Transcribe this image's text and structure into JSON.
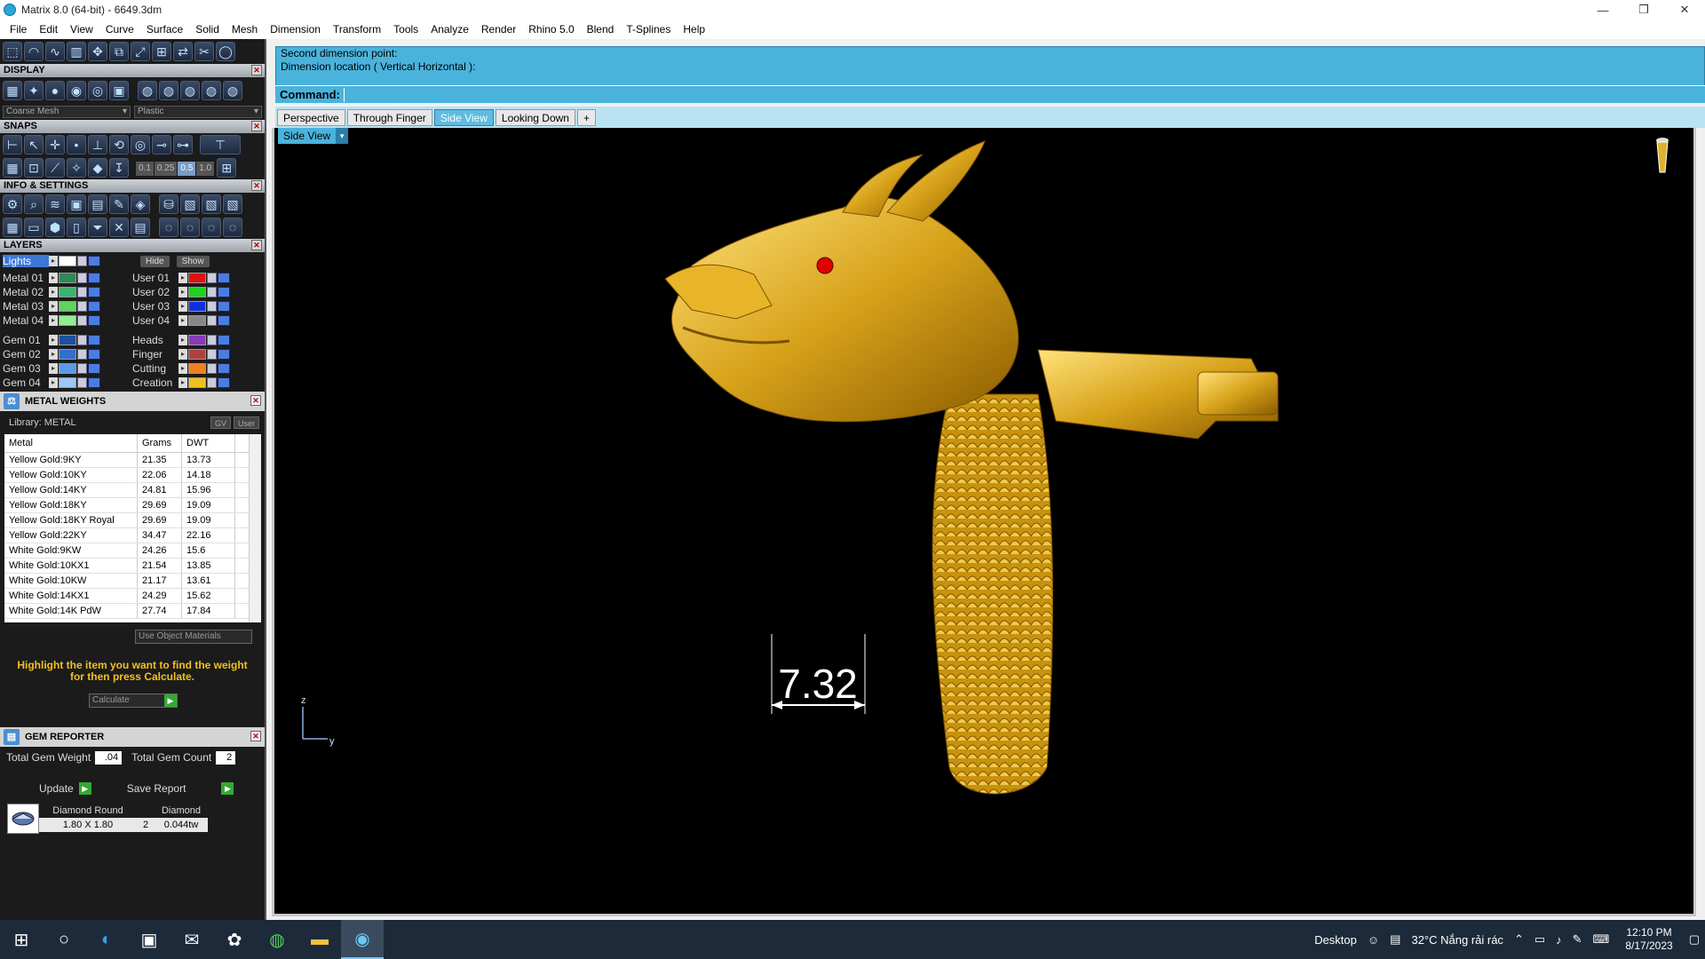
{
  "window": {
    "title": "Matrix 8.0 (64-bit) - 6649.3dm",
    "min": "—",
    "restore": "❐",
    "close": "✕"
  },
  "menu": [
    "File",
    "Edit",
    "View",
    "Curve",
    "Surface",
    "Solid",
    "Mesh",
    "Dimension",
    "Transform",
    "Tools",
    "Analyze",
    "Render",
    "Rhino 5.0",
    "Blend",
    "T-Splines",
    "Help"
  ],
  "display": {
    "header": "DISPLAY",
    "mesh": "Coarse Mesh",
    "material": "Plastic"
  },
  "snaps": {
    "header": "SNAPS",
    "values": [
      "0.1",
      "0.25",
      "0.5",
      "1.0"
    ]
  },
  "info": {
    "header": "INFO & SETTINGS"
  },
  "layers": {
    "header": "LAYERS",
    "lights": "Lights",
    "hide": "Hide",
    "show": "Show",
    "left": [
      {
        "name": "Metal 01",
        "color": "#2e8b57"
      },
      {
        "name": "Metal 02",
        "color": "#3cb371"
      },
      {
        "name": "Metal 03",
        "color": "#5fd35f"
      },
      {
        "name": "Metal 04",
        "color": "#90ee90"
      },
      {
        "name": "Gem 01",
        "color": "#1e4fa0"
      },
      {
        "name": "Gem 02",
        "color": "#2e6fd0"
      },
      {
        "name": "Gem 03",
        "color": "#5a9ae8"
      },
      {
        "name": "Gem 04",
        "color": "#9ec8f5"
      }
    ],
    "right": [
      {
        "name": "User 01",
        "color": "#e01010"
      },
      {
        "name": "User 02",
        "color": "#20d020"
      },
      {
        "name": "User 03",
        "color": "#1030e0"
      },
      {
        "name": "User 04",
        "color": "#888888"
      },
      {
        "name": "Heads",
        "color": "#8a3ab9"
      },
      {
        "name": "Finger",
        "color": "#b04040"
      },
      {
        "name": "Cutting",
        "color": "#f08020"
      },
      {
        "name": "Creation",
        "color": "#f0c020"
      }
    ]
  },
  "metal_weights": {
    "header": "METAL WEIGHTS",
    "library": "Library: METAL",
    "gv": "GV",
    "user": "User",
    "columns": [
      "Metal",
      "Grams",
      "DWT"
    ],
    "rows": [
      [
        "Yellow Gold:9KY",
        "21.35",
        "13.73"
      ],
      [
        "Yellow Gold:10KY",
        "22.06",
        "14.18"
      ],
      [
        "Yellow Gold:14KY",
        "24.81",
        "15.96"
      ],
      [
        "Yellow Gold:18KY",
        "29.69",
        "19.09"
      ],
      [
        "Yellow Gold:18KY Royal",
        "29.69",
        "19.09"
      ],
      [
        "Yellow Gold:22KY",
        "34.47",
        "22.16"
      ],
      [
        "White Gold:9KW",
        "24.26",
        "15.6"
      ],
      [
        "White Gold:10KX1",
        "21.54",
        "13.85"
      ],
      [
        "White Gold:10KW",
        "21.17",
        "13.61"
      ],
      [
        "White Gold:14KX1",
        "24.29",
        "15.62"
      ],
      [
        "White Gold:14K PdW",
        "27.74",
        "17.84"
      ]
    ],
    "use_object_materials": "Use Object Materials",
    "hint": "Highlight the item you want to find the weight for then press Calculate.",
    "calculate": "Calculate"
  },
  "gem_reporter": {
    "header": "GEM REPORTER",
    "total_weight_label": "Total Gem Weight",
    "total_weight": ".04",
    "total_count_label": "Total Gem Count",
    "total_count": "2",
    "update": "Update",
    "save_report": "Save Report",
    "gem": {
      "shape": "Diamond Round",
      "type": "Diamond",
      "size": "1.80 X 1.80",
      "count": "2",
      "weight": "0.044tw"
    }
  },
  "command": {
    "history": [
      "Second dimension point:",
      "Dimension location ( Vertical  Horizontal ):"
    ],
    "label": "Command:"
  },
  "tabs": [
    "Perspective",
    "Through Finger",
    "Side View",
    "Looking Down",
    "+"
  ],
  "active_tab": "Side View",
  "viewport": {
    "label": "Side View",
    "dimension": "7.32",
    "axis_z": "z",
    "axis_y": "y"
  },
  "taskbar": {
    "desktop": "Desktop",
    "weather": "32°C  Nắng rải rác",
    "time": "12:10 PM",
    "date": "8/17/2023"
  }
}
